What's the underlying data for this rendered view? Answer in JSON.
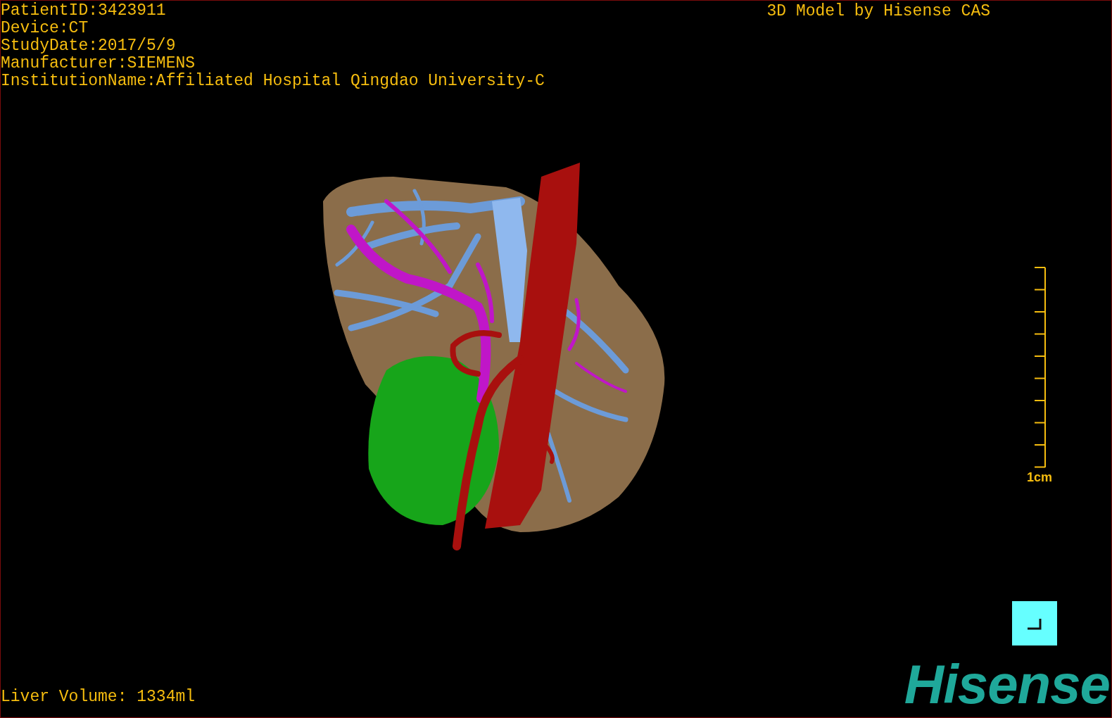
{
  "patient_info": [
    "PatientID:3423911",
    "Device:CT",
    "StudyDate:2017/5/9",
    "Manufacturer:SIEMENS",
    "InstitutionName:Affiliated Hospital Qingdao University-C"
  ],
  "title": "3D Model by Hisense CAS",
  "scale": {
    "label": "1cm"
  },
  "liver_volume": "Liver Volume: 1334ml",
  "logo": "Hisense"
}
